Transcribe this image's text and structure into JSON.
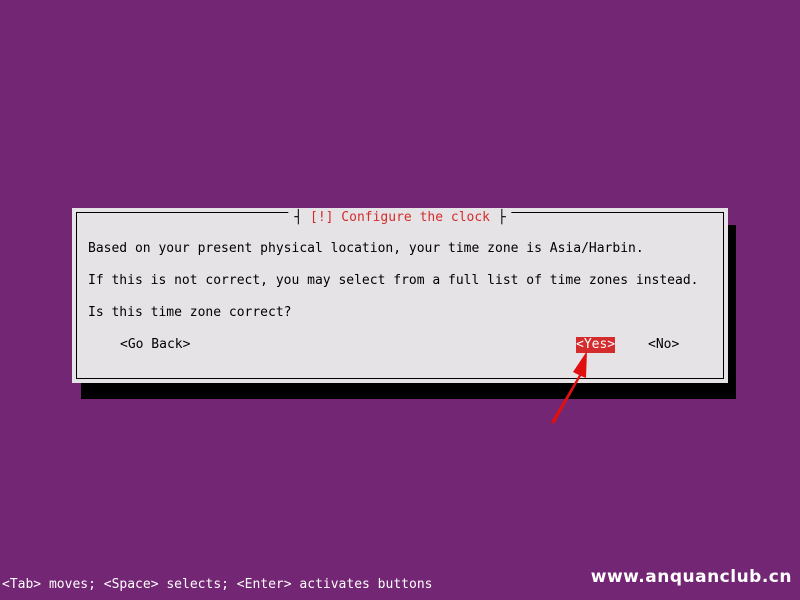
{
  "dialog": {
    "title": "[!] Configure the clock",
    "lines": [
      "Based on your present physical location, your time zone is Asia/Harbin.",
      "If this is not correct, you may select from a full list of time zones instead.",
      "Is this time zone correct?"
    ],
    "buttons": {
      "back": "<Go Back>",
      "yes": "<Yes>",
      "no": "<No>"
    },
    "selected_button": "yes"
  },
  "footer": {
    "help": "<Tab> moves; <Space> selects; <Enter> activates buttons"
  },
  "watermark": {
    "text": "www.anquanclub.cn"
  },
  "colors": {
    "background": "#732673",
    "dialog": "#e6e3e6",
    "accent": "#d42c2c"
  }
}
